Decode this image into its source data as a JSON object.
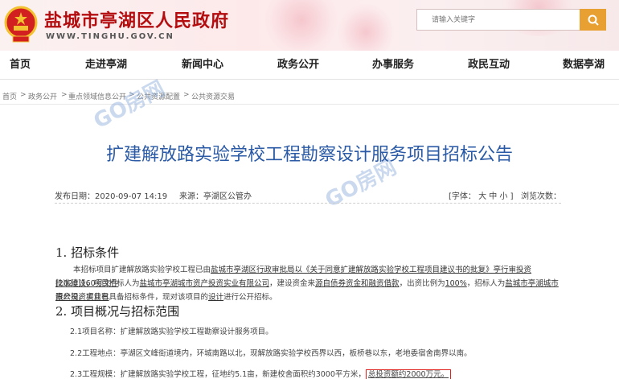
{
  "header": {
    "site_title": "盐城市亭湖区人民政府",
    "site_url": "WWW.TINGHU.GOV.CN",
    "search_placeholder": "请输入关键字"
  },
  "nav": {
    "items": [
      "首页",
      "走进亭湖",
      "新闻中心",
      "政务公开",
      "办事服务",
      "政民互动",
      "数据亭湖"
    ]
  },
  "breadcrumb": {
    "items": [
      "首页",
      "政务公开",
      "重点领域信息公开",
      "公共资源配置",
      "公共资源交易"
    ],
    "separator": ">"
  },
  "article": {
    "title": "扩建解放路实验学校工程勘察设计服务项目招标公告",
    "publish_date": "发布日期：2020-09-07 14:19",
    "source": "来源：亭湖区公管办",
    "font_size": "[字体： 大 中 小 ]",
    "views": "浏览次数：",
    "section1_title": "1. 招标条件",
    "section1_p1_a": "本招标项目扩建解放路实验学校工程已由",
    "section1_p1_b": "盐城市亭湖区行政审批局以《关于同意扩建解放路实验学校工程项目建议书的批复》亭行审投资[2020]160号文件",
    "section1_p2_a": "批准建设，项目招标人为",
    "section1_p2_b": "盐城市亭湖城市资产投资实业有限公司",
    "section1_p2_c": "，建设资金来",
    "section1_p2_d": "源自债券资金和融资借款",
    "section1_p2_e": "，出资比例为",
    "section1_p2_f": "100%",
    "section1_p2_g": "，招标人为",
    "section1_p2_h": "盐城市亭湖城市资产投资实业有",
    "section1_p3_a": "限公司",
    "section1_p3_b": "。项目已具备招标条件，现对该项目的",
    "section1_p3_c": "设计",
    "section1_p3_d": "进行公开招标。",
    "section2_title": "2. 项目概况与招标范围",
    "item1": "2.1项目名称：扩建解放路实验学校工程勘察设计服务项目。",
    "item2": "2.2工程地点：亭湖区文峰街道境内，环城南路以北，现解放路实验学校西界以西，板桥巷以东，老地委宿舍南界以南。",
    "item3_a": "2.3工程规模：扩建解放路实验学校工程，征地约5.1亩，新建校舍面积约3000平方米，",
    "item3_b": "总投资额约2000万元。"
  },
  "watermark": "GO房网",
  "colors": {
    "brand_red": "#b30d10",
    "title_blue": "#2a5aa5",
    "search_orange": "#e8a033",
    "highlight_red": "#e0201c"
  }
}
